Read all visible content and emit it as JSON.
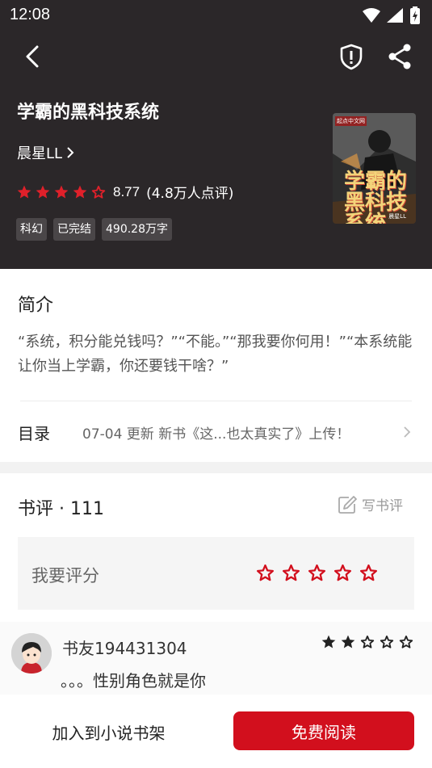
{
  "status_bar": {
    "time": "12:08"
  },
  "book": {
    "title": "学霸的黑科技系统",
    "author": "晨星LL",
    "rating_score": "8.77",
    "rating_count": "(4.8万人点评)",
    "rating_value": 4.5,
    "tags": [
      "科幻",
      "已完结",
      "490.28万字"
    ],
    "cover": {
      "badge": "起点中文网",
      "title": "学霸的黑科技系统",
      "author": "晨星LL"
    }
  },
  "intro": {
    "label": "简介",
    "text": "“系统，积分能兑钱吗？”“不能。”“那我要你何用！”“本系统能让你当上学霸，你还要钱干啥？”"
  },
  "toc": {
    "label": "目录",
    "update": "07-04  更新  新书《这...也太真实了》上传！"
  },
  "reviews": {
    "title": "书评 · 111",
    "write_label": "写书评",
    "rate_label": "我要评分",
    "comments": [
      {
        "user": "书友194431304",
        "stars": 2,
        "text": "。。。性别角色就是你"
      }
    ]
  },
  "bottom": {
    "shelf_label": "加入到小说书架",
    "read_label": "免费阅读"
  },
  "colors": {
    "accent": "#d20f1d",
    "header_bg": "#2b2729"
  }
}
